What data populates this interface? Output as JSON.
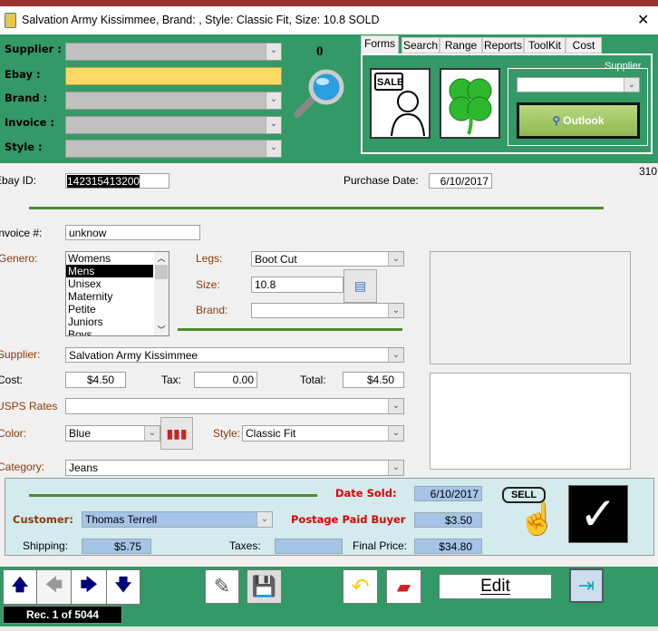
{
  "window": {
    "title": "Salvation Army Kissimmee, Brand: ,  Style: Classic Fit, Size: 10.8  SOLD",
    "close": "✕"
  },
  "search": {
    "labels": {
      "supplier": "Supplier :",
      "ebay": "Ebay :",
      "brand": "Brand :",
      "invoice": "Invoice :",
      "style": "Style :"
    },
    "count": "0",
    "highlight_color": "#ffd966"
  },
  "tabs": [
    {
      "label": "Forms"
    },
    {
      "label": "Search"
    },
    {
      "label": "Range"
    },
    {
      "label": "Reports"
    },
    {
      "label": "ToolKit"
    },
    {
      "label": "Cost"
    }
  ],
  "forms_panel": {
    "supplier_label": "Supplier",
    "outlook_label": "Outlook",
    "sale_text": "SALE"
  },
  "record": {
    "corner_number": "310",
    "ebay_id_label": "Ebay ID:",
    "ebay_id": "142315413200",
    "purchase_date_label": "Purchase  Date:",
    "purchase_date": "6/10/2017",
    "invoice_label": "Invoice #:",
    "invoice": "unknow",
    "genero_label": "Genero:",
    "genero_options": [
      "Womens",
      "Mens",
      "Unisex",
      "Maternity",
      "Petite",
      "Juniors",
      "Boys"
    ],
    "genero_selected": "Mens",
    "legs_label": "Legs:",
    "legs": "Boot Cut",
    "size_label": "Size:",
    "size": "10.8",
    "brand_label": "Brand:",
    "brand": "",
    "supplier_label": "Supplier:",
    "supplier": "Salvation Army Kissimmee",
    "cost_label": "Cost:",
    "cost": "$4.50",
    "tax_label": "Tax:",
    "tax": "0.00",
    "total_label": "Total:",
    "total": "$4.50",
    "usps_label": "USPS Rates",
    "usps": "",
    "color_label": "Color:",
    "color": "Blue",
    "style_label": "Style:",
    "style": "Classic Fit",
    "category_label": "Category:",
    "category": "Jeans"
  },
  "sold": {
    "date_sold_label": "Date Sold:",
    "date_sold": "6/10/2017",
    "customer_label": "Customer:",
    "customer": "Thomas Terrell",
    "postage_label": "Postage Paid Buyer",
    "postage": "$3.50",
    "shipping_label": "Shipping:",
    "shipping": "$5.75",
    "taxes_label": "Taxes:",
    "taxes": "",
    "final_label": "Final Price:",
    "final": "$34.80",
    "sell_text": "SELL"
  },
  "footer": {
    "record_counter": "Rec. 1 of 5044",
    "edit_label": "Edit"
  },
  "colors": {
    "green": "#339966",
    "sold_panel": "#d4ebee",
    "field_blue": "#a6c4e8",
    "red_label": "#e00000"
  }
}
